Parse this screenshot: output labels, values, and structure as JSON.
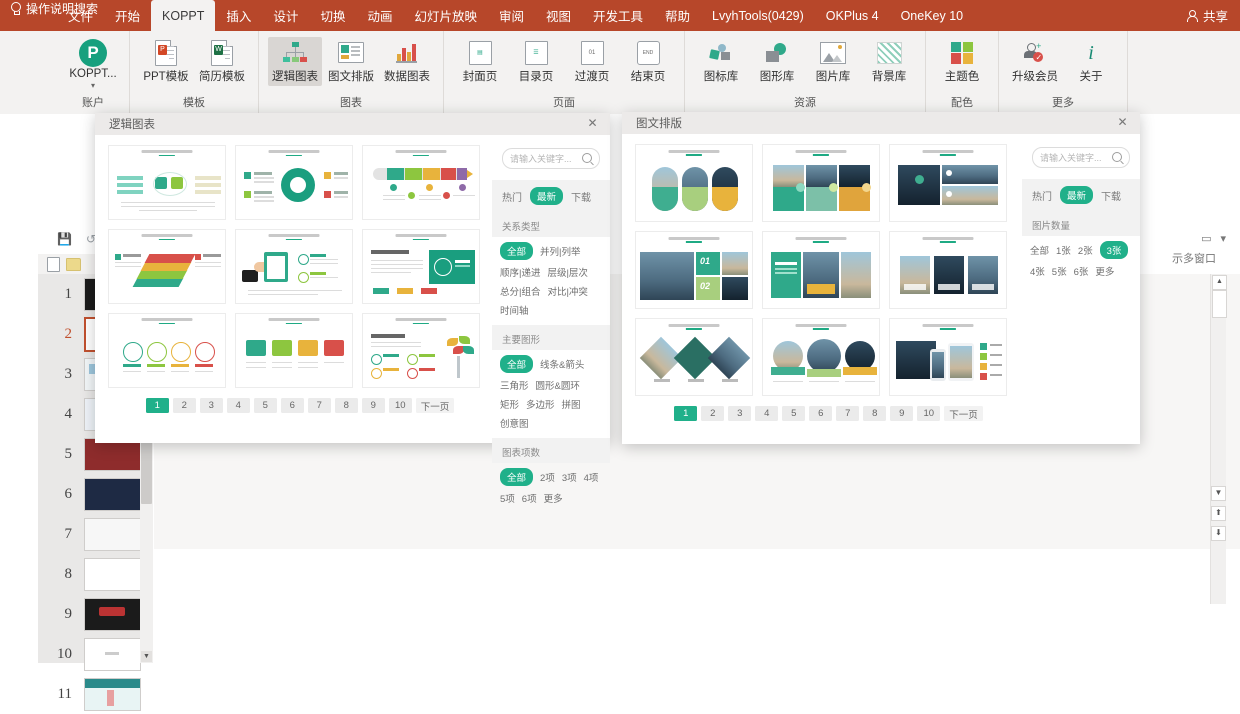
{
  "ribbon": {
    "tabs": [
      {
        "label": "文件",
        "active": false
      },
      {
        "label": "开始",
        "active": false
      },
      {
        "label": "KOPPT",
        "active": true
      },
      {
        "label": "插入",
        "active": false
      },
      {
        "label": "设计",
        "active": false
      },
      {
        "label": "切换",
        "active": false
      },
      {
        "label": "动画",
        "active": false
      },
      {
        "label": "幻灯片放映",
        "active": false
      },
      {
        "label": "审阅",
        "active": false
      },
      {
        "label": "视图",
        "active": false
      },
      {
        "label": "开发工具",
        "active": false
      },
      {
        "label": "帮助",
        "active": false
      },
      {
        "label": "LvyhTools(0429)",
        "active": false
      },
      {
        "label": "OKPlus 4",
        "active": false
      },
      {
        "label": "OneKey 10",
        "active": false
      }
    ],
    "search_label": "操作说明搜索",
    "share_label": "共享",
    "groups": [
      {
        "label": "账户",
        "items": [
          {
            "label": "KOPPT...",
            "icon": "koppt-logo-icon",
            "selected": false
          }
        ]
      },
      {
        "label": "模板",
        "items": [
          {
            "label": "PPT模板",
            "icon": "ppt-file-icon",
            "selected": false
          },
          {
            "label": "简历模板",
            "icon": "resume-file-icon",
            "selected": false
          }
        ]
      },
      {
        "label": "图表",
        "items": [
          {
            "label": "逻辑图表",
            "icon": "flowchart-icon",
            "selected": true
          },
          {
            "label": "图文排版",
            "icon": "image-text-icon",
            "selected": false
          },
          {
            "label": "数据图表",
            "icon": "bar-chart-icon",
            "selected": false
          }
        ]
      },
      {
        "label": "页面",
        "items": [
          {
            "label": "封面页",
            "icon": "cover-page-icon",
            "selected": false
          },
          {
            "label": "目录页",
            "icon": "toc-page-icon",
            "selected": false
          },
          {
            "label": "过渡页",
            "icon": "transition-page-icon",
            "selected": false
          },
          {
            "label": "结束页",
            "icon": "end-page-icon",
            "selected": false
          }
        ]
      },
      {
        "label": "资源",
        "items": [
          {
            "label": "图标库",
            "icon": "icon-library-icon",
            "selected": false
          },
          {
            "label": "图形库",
            "icon": "shape-library-icon",
            "selected": false
          },
          {
            "label": "图片库",
            "icon": "picture-library-icon",
            "selected": false
          },
          {
            "label": "背景库",
            "icon": "background-library-icon",
            "selected": false
          }
        ]
      },
      {
        "label": "配色",
        "items": [
          {
            "label": "主题色",
            "icon": "theme-color-icon",
            "selected": false
          }
        ]
      },
      {
        "label": "更多",
        "items": [
          {
            "label": "升级会员",
            "icon": "upgrade-vip-icon",
            "selected": false
          },
          {
            "label": "关于",
            "icon": "info-icon",
            "selected": false
          }
        ]
      }
    ],
    "collapse_icon": "chevron-up-icon"
  },
  "workspace": {
    "multi_window_label": "示多窗口",
    "slides": [
      {
        "num": "1",
        "selected": false
      },
      {
        "num": "2",
        "selected": true
      },
      {
        "num": "3",
        "selected": false
      },
      {
        "num": "4",
        "selected": false
      },
      {
        "num": "5",
        "selected": false
      },
      {
        "num": "6",
        "selected": false
      },
      {
        "num": "7",
        "selected": false
      },
      {
        "num": "8",
        "selected": false
      },
      {
        "num": "9",
        "selected": false
      },
      {
        "num": "10",
        "selected": false
      },
      {
        "num": "11",
        "selected": false
      }
    ]
  },
  "dialog_logic": {
    "title": "逻辑图表",
    "close_label": "✕",
    "search": {
      "placeholder": "请输入关键字...",
      "value": ""
    },
    "tabs": [
      {
        "label": "热门",
        "active": false
      },
      {
        "label": "最新",
        "active": true
      },
      {
        "label": "下载",
        "active": false
      }
    ],
    "filters": [
      {
        "title": "关系类型",
        "chips": [
          {
            "label": "全部",
            "active": true
          },
          {
            "label": "并列|列举",
            "active": false
          },
          {
            "label": "顺序|递进",
            "active": false
          },
          {
            "label": "层级|层次",
            "active": false
          },
          {
            "label": "总分|组合",
            "active": false
          },
          {
            "label": "对比|冲突",
            "active": false
          },
          {
            "label": "时间轴",
            "active": false
          }
        ]
      },
      {
        "title": "主要图形",
        "chips": [
          {
            "label": "全部",
            "active": true
          },
          {
            "label": "线条&箭头",
            "active": false
          },
          {
            "label": "三角形",
            "active": false
          },
          {
            "label": "圆形&圆环",
            "active": false
          },
          {
            "label": "矩形",
            "active": false
          },
          {
            "label": "多边形",
            "active": false
          },
          {
            "label": "拼图",
            "active": false
          },
          {
            "label": "创意图",
            "active": false
          }
        ]
      },
      {
        "title": "图表项数",
        "chips": [
          {
            "label": "全部",
            "active": true
          },
          {
            "label": "2项",
            "active": false
          },
          {
            "label": "3项",
            "active": false
          },
          {
            "label": "4项",
            "active": false
          },
          {
            "label": "5项",
            "active": false
          },
          {
            "label": "6项",
            "active": false
          },
          {
            "label": "更多",
            "active": false
          }
        ]
      }
    ],
    "pager": [
      {
        "label": "1",
        "active": true
      },
      {
        "label": "2",
        "active": false
      },
      {
        "label": "3",
        "active": false
      },
      {
        "label": "4",
        "active": false
      },
      {
        "label": "5",
        "active": false
      },
      {
        "label": "6",
        "active": false
      },
      {
        "label": "7",
        "active": false
      },
      {
        "label": "8",
        "active": false
      },
      {
        "label": "9",
        "active": false
      },
      {
        "label": "10",
        "active": false
      },
      {
        "label": "下一页",
        "active": false
      }
    ]
  },
  "dialog_layout": {
    "title": "图文排版",
    "close_label": "✕",
    "search": {
      "placeholder": "请输入关键字...",
      "value": ""
    },
    "tabs": [
      {
        "label": "热门",
        "active": false
      },
      {
        "label": "最新",
        "active": true
      },
      {
        "label": "下载",
        "active": false
      }
    ],
    "filters": [
      {
        "title": "图片数量",
        "chips": [
          {
            "label": "全部",
            "active": false
          },
          {
            "label": "1张",
            "active": false
          },
          {
            "label": "2张",
            "active": false
          },
          {
            "label": "3张",
            "active": true
          },
          {
            "label": "4张",
            "active": false
          },
          {
            "label": "5张",
            "active": false
          },
          {
            "label": "6张",
            "active": false
          },
          {
            "label": "更多",
            "active": false
          }
        ]
      }
    ],
    "pager": [
      {
        "label": "1",
        "active": true
      },
      {
        "label": "2",
        "active": false
      },
      {
        "label": "3",
        "active": false
      },
      {
        "label": "4",
        "active": false
      },
      {
        "label": "5",
        "active": false
      },
      {
        "label": "6",
        "active": false
      },
      {
        "label": "7",
        "active": false
      },
      {
        "label": "8",
        "active": false
      },
      {
        "label": "9",
        "active": false
      },
      {
        "label": "10",
        "active": false
      },
      {
        "label": "下一页",
        "active": false
      }
    ]
  },
  "colors": {
    "ribbon_red": "#b7472a",
    "accent_teal": "#20b08a",
    "selected_slide_border": "#c0502e"
  }
}
